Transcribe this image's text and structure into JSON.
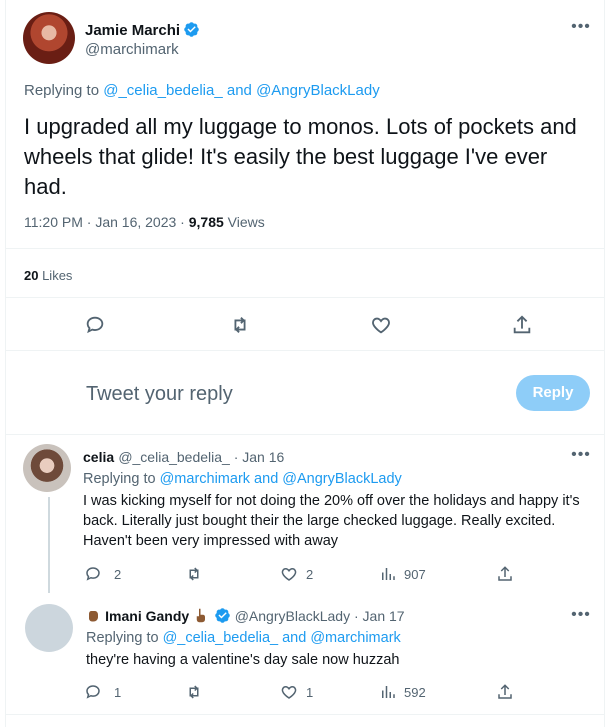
{
  "main_tweet": {
    "author_name": "Jamie Marchi",
    "handle": "@marchimark",
    "replying_prefix": "Replying to ",
    "replying_to_1": "@_celia_bedelia_",
    "replying_and": " and ",
    "replying_to_2": "@AngryBlackLady",
    "text": "I upgraded all my luggage to monos. Lots of pockets and wheels that glide! It's easily the best luggage I've ever had.",
    "timestamp": "11:20 PM · Jan 16, 2023 · ",
    "views_count": "9,785",
    "views_label": " Views",
    "likes_count": "20",
    "likes_label": " Likes"
  },
  "composer": {
    "placeholder": "Tweet your reply",
    "button_label": "Reply"
  },
  "replies": [
    {
      "author_name": "celia",
      "handle_date": "@_celia_bedelia_ · Jan 16",
      "replying_prefix": "Replying to ",
      "replying_to_1": "@marchimark",
      "replying_and": " and ",
      "replying_to_2": "@AngryBlackLady",
      "text": "I was kicking myself for not doing the 20% off over the holidays and happy it's back. Literally just bought their the large checked luggage. Really excited. Haven't been very impressed with away",
      "reply_count": "2",
      "retweet_count": "",
      "like_count": "2",
      "view_count": "907"
    },
    {
      "author_name": "Imani Gandy",
      "handle_date": "@AngryBlackLady · Jan 17",
      "replying_prefix": "Replying to ",
      "replying_to_1": "@_celia_bedelia_",
      "replying_and": " and ",
      "replying_to_2": "@marchimark",
      "text": "they're having a valentine's day sale now huzzah",
      "reply_count": "1",
      "retweet_count": "",
      "like_count": "1",
      "view_count": "592"
    }
  ],
  "colors": {
    "accent": "#1d9bf0",
    "muted": "#536471",
    "reply_button_disabled": "#8ecdf8"
  },
  "icons": [
    "verified-badge-icon",
    "more-icon",
    "reply-icon",
    "retweet-icon",
    "like-icon",
    "share-icon",
    "views-icon",
    "raised-fist-emoji-icon",
    "pointing-hand-emoji-icon"
  ]
}
